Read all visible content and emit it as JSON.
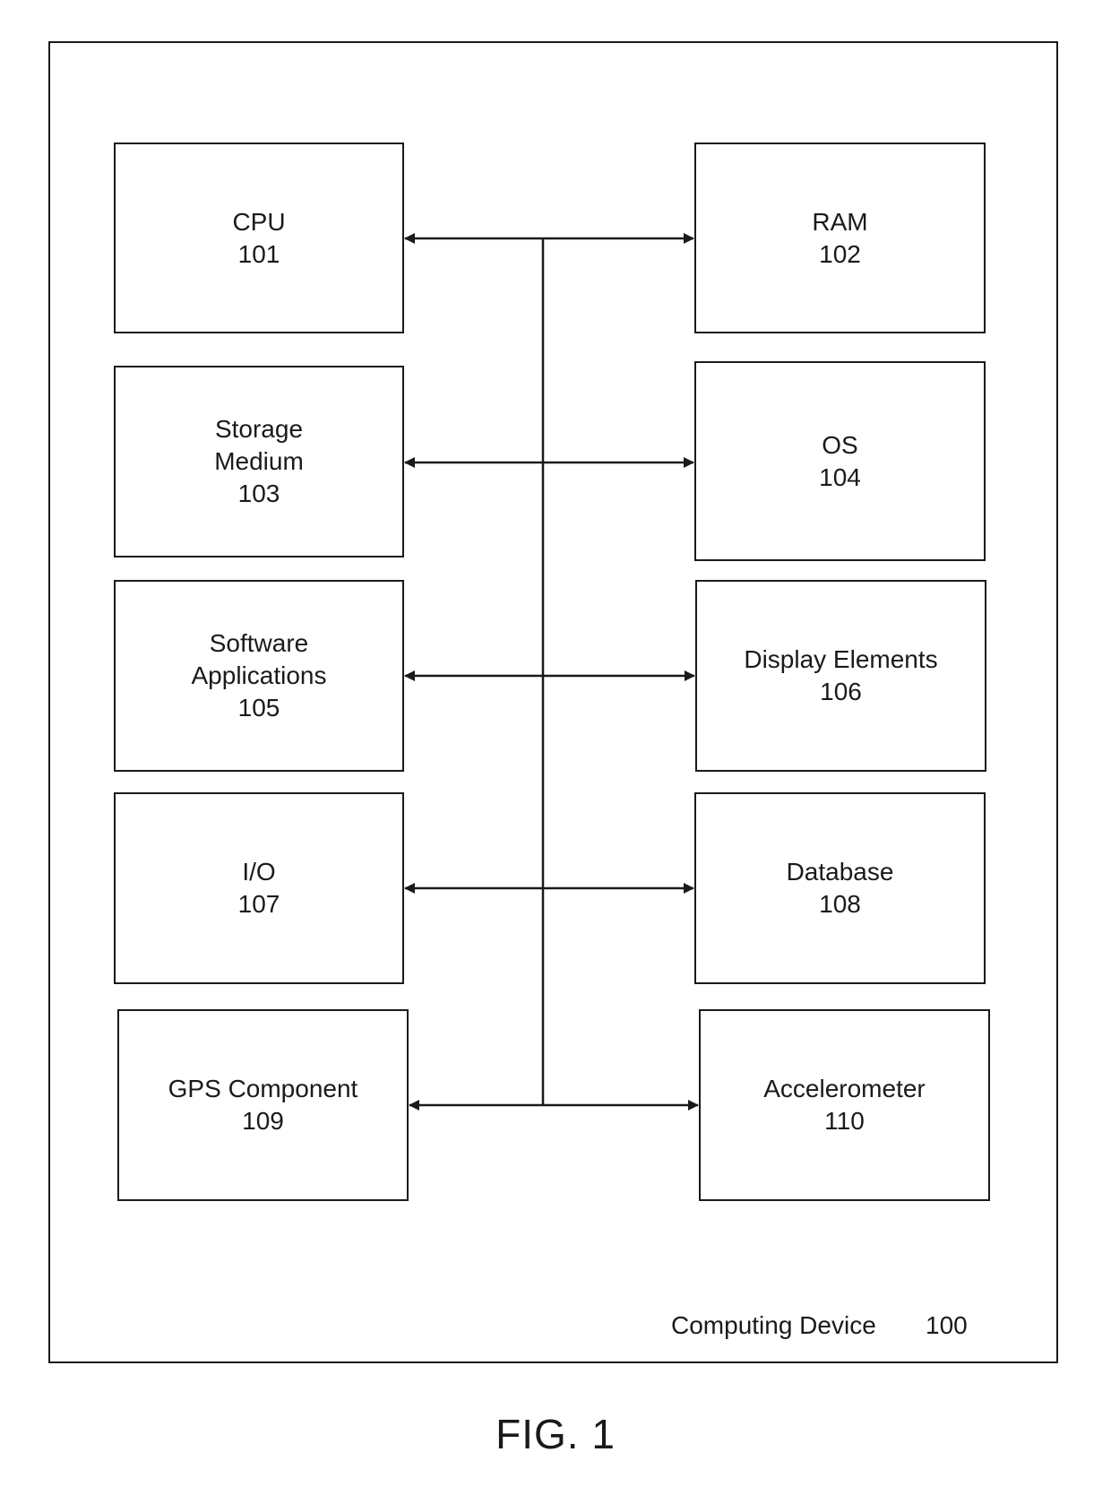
{
  "figure": {
    "title": "FIG. 1",
    "container_label": "Computing Device",
    "container_ref": "100"
  },
  "components": [
    {
      "id": "cpu",
      "label": "CPU",
      "ref": "101",
      "column": "left"
    },
    {
      "id": "ram",
      "label": "RAM",
      "ref": "102",
      "column": "right"
    },
    {
      "id": "storage",
      "label": "Storage\nMedium",
      "ref": "103",
      "column": "left"
    },
    {
      "id": "os",
      "label": "OS",
      "ref": "104",
      "column": "right"
    },
    {
      "id": "software",
      "label": "Software\nApplications",
      "ref": "105",
      "column": "left"
    },
    {
      "id": "display",
      "label": "Display Elements",
      "ref": "106",
      "column": "right"
    },
    {
      "id": "io",
      "label": "I/O",
      "ref": "107",
      "column": "left"
    },
    {
      "id": "database",
      "label": "Database",
      "ref": "108",
      "column": "right"
    },
    {
      "id": "gps",
      "label": "GPS Component",
      "ref": "109",
      "column": "left"
    },
    {
      "id": "accel",
      "label": "Accelerometer",
      "ref": "110",
      "column": "right"
    }
  ],
  "connections": [
    {
      "from": "bus",
      "to": [
        "cpu",
        "ram"
      ],
      "type": "bidirectional"
    },
    {
      "from": "bus",
      "to": [
        "storage",
        "os"
      ],
      "type": "bidirectional"
    },
    {
      "from": "bus",
      "to": [
        "software",
        "display"
      ],
      "type": "bidirectional"
    },
    {
      "from": "bus",
      "to": [
        "io",
        "database"
      ],
      "type": "bidirectional"
    },
    {
      "from": "bus",
      "to": [
        "gps",
        "accel"
      ],
      "type": "bidirectional"
    }
  ],
  "colors": {
    "stroke": "#1a1a1a",
    "background": "#ffffff"
  }
}
